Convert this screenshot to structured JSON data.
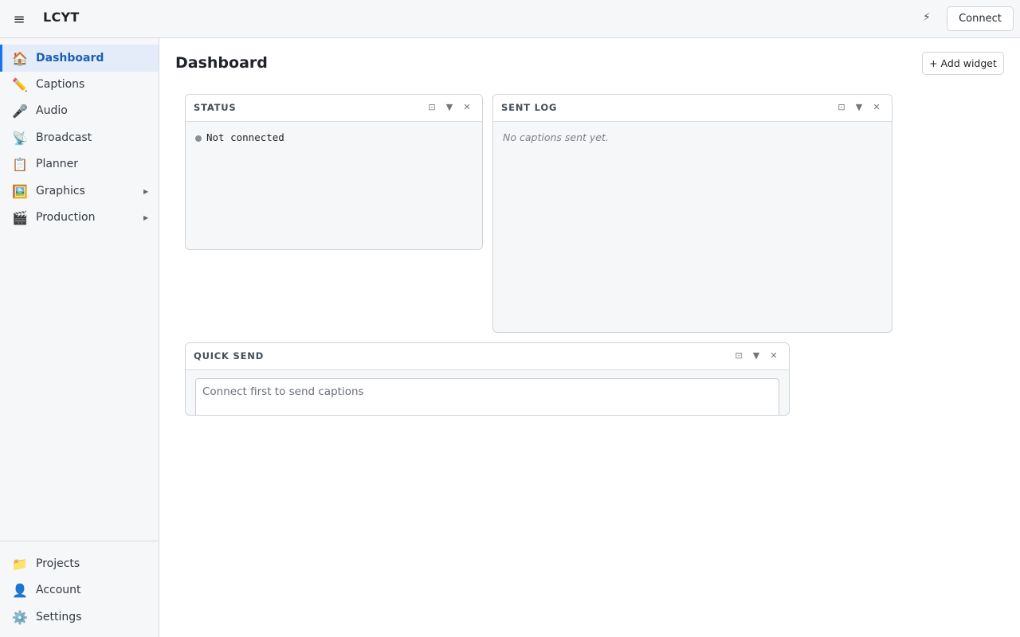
{
  "app": {
    "title": "LCYT"
  },
  "topbar": {
    "connect_label": "Connect",
    "bolt_icon": "⚡",
    "menu_icon": "≡"
  },
  "sidebar": {
    "items": [
      {
        "icon": "🏠",
        "label": "Dashboard"
      },
      {
        "icon": "✏️",
        "label": "Captions"
      },
      {
        "icon": "🎤",
        "label": "Audio"
      },
      {
        "icon": "📡",
        "label": "Broadcast"
      },
      {
        "icon": "📋",
        "label": "Planner"
      },
      {
        "icon": "🖼️",
        "label": "Graphics",
        "expandable": true
      },
      {
        "icon": "🎬",
        "label": "Production",
        "expandable": true
      }
    ],
    "bottom_items": [
      {
        "icon": "📁",
        "label": "Projects"
      },
      {
        "icon": "👤",
        "label": "Account"
      },
      {
        "icon": "⚙️",
        "label": "Settings"
      }
    ],
    "active": "Dashboard",
    "accent_color": "#1a73e8"
  },
  "main": {
    "title": "Dashboard",
    "add_widget_label": "+ Add widget"
  },
  "widgets": {
    "status": {
      "title": "STATUS",
      "status_text": "Not connected"
    },
    "sent_log": {
      "title": "SENT LOG",
      "empty_text": "No captions sent yet."
    },
    "quick_send": {
      "title": "QUICK SEND",
      "placeholder": "Connect first to send captions"
    },
    "controls": {
      "minimize": "⊡",
      "collapse": "▼",
      "close": "✕"
    }
  }
}
